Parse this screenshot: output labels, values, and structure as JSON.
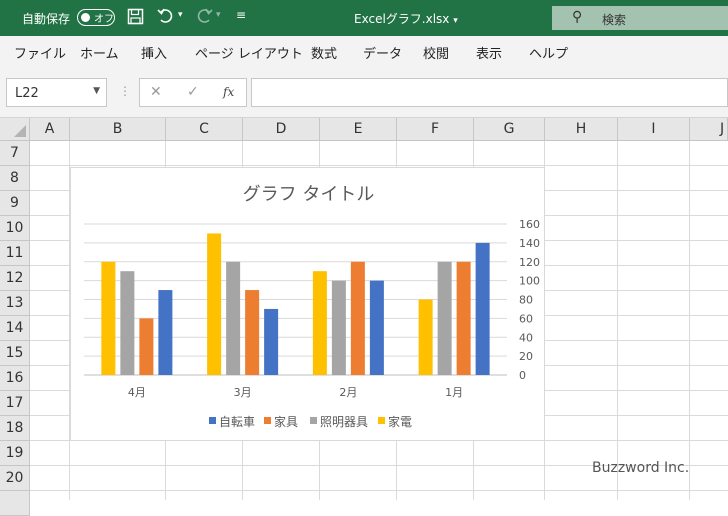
{
  "titlebar": {
    "autosave_label": "自動保存",
    "toggle_label": "オフ",
    "doc_name": "Excelグラフ.xlsx",
    "search_label": "検索"
  },
  "menu": [
    "ファイル",
    "ホーム",
    "挿入",
    "ページ レイアウト",
    "数式",
    "データ",
    "校閲",
    "表示",
    "ヘルプ"
  ],
  "formula_bar": {
    "name_box": "L22",
    "fx": "fx",
    "value": ""
  },
  "columns": [
    "A",
    "B",
    "C",
    "D",
    "E",
    "F",
    "G",
    "H",
    "I",
    "J"
  ],
  "rows": [
    "7",
    "8",
    "9",
    "10",
    "11",
    "12",
    "13",
    "14",
    "15",
    "16",
    "17",
    "18",
    "19",
    "20"
  ],
  "watermark": "Buzzword Inc.",
  "colors": {
    "title_bar": "#217346",
    "car": "#4472c4",
    "furniture": "#ed7d31",
    "lighting": "#a5a5a5",
    "appliance": "#ffc000"
  },
  "chart_data": {
    "type": "bar",
    "title": "グラフ タイトル",
    "categories": [
      "4月",
      "3月",
      "2月",
      "1月"
    ],
    "series": [
      {
        "name": "家電",
        "color": "#ffc000",
        "values": [
          120,
          150,
          110,
          80
        ]
      },
      {
        "name": "照明器具",
        "color": "#a5a5a5",
        "values": [
          110,
          120,
          100,
          120
        ]
      },
      {
        "name": "家具",
        "color": "#ed7d31",
        "values": [
          60,
          90,
          120,
          120
        ]
      },
      {
        "name": "自転車",
        "color": "#4472c4",
        "values": [
          90,
          70,
          100,
          140
        ]
      }
    ],
    "legend_order": [
      "自転車",
      "家具",
      "照明器具",
      "家電"
    ],
    "ylim": [
      0,
      160
    ],
    "yticks": [
      "0",
      "20",
      "40",
      "60",
      "80",
      "100",
      "120",
      "140",
      "160"
    ],
    "y_axis_side": "right",
    "grid": true,
    "legend_position": "bottom"
  }
}
